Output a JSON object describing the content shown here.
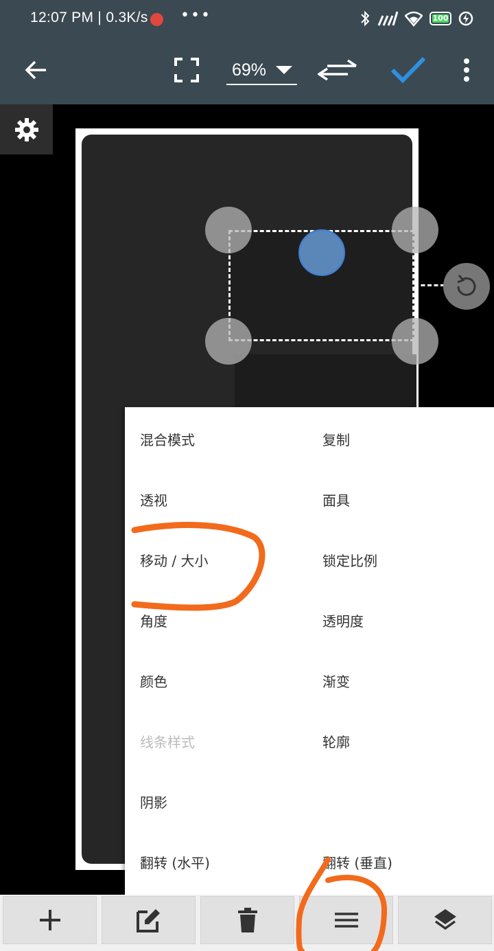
{
  "status_bar": {
    "time": "12:07 PM",
    "net_speed": "0.3K/s",
    "battery": "100",
    "icons": [
      "bluetooth-icon",
      "signal-icon",
      "wifi-icon",
      "battery-icon",
      "charging-icon"
    ]
  },
  "toolbar": {
    "zoom": "69%",
    "icons": [
      "back-arrow-icon",
      "fullscreen-icon",
      "swap-icon",
      "check-icon",
      "more-vert-icon"
    ]
  },
  "colors": {
    "bar_bg": "#3b4952",
    "accent_check": "#2f8fe0",
    "annotation": "#f26a1b"
  },
  "menu": {
    "left": [
      "混合模式",
      "透视",
      "移动 / 大小",
      "角度",
      "颜色",
      "线条样式",
      "阴影",
      "翻转 (水平)"
    ],
    "right": [
      "复制",
      "面具",
      "锁定比例",
      "透明度",
      "渐变",
      "轮廓",
      "翻转 (垂直)"
    ],
    "disabled": [
      "线条样式"
    ]
  },
  "bottom_bar": {
    "icons": [
      "add-icon",
      "edit-icon",
      "delete-icon",
      "menu-icon",
      "layers-icon"
    ]
  }
}
